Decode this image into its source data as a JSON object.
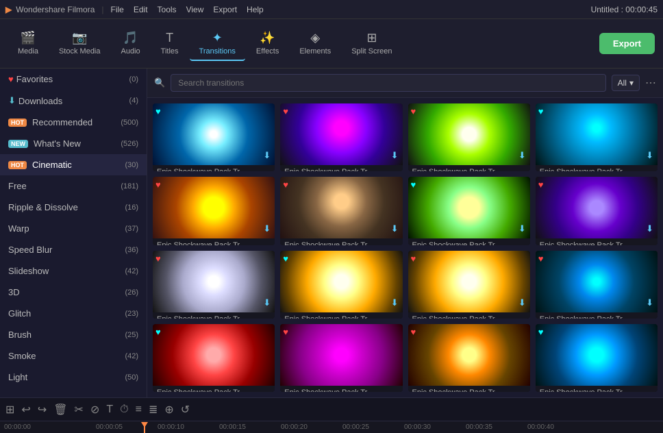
{
  "topbar": {
    "logo": "Wondershare Filmora",
    "menus": [
      "File",
      "Edit",
      "Tools",
      "View",
      "Export",
      "Help"
    ],
    "title": "Untitled : 00:00:45"
  },
  "toolbar": {
    "items": [
      {
        "id": "media",
        "label": "Media",
        "icon": "🎬"
      },
      {
        "id": "stock",
        "label": "Stock Media",
        "icon": "📷"
      },
      {
        "id": "audio",
        "label": "Audio",
        "icon": "🎵"
      },
      {
        "id": "titles",
        "label": "Titles",
        "icon": "T"
      },
      {
        "id": "transitions",
        "label": "Transitions",
        "icon": "✦",
        "active": true
      },
      {
        "id": "effects",
        "label": "Effects",
        "icon": "✨"
      },
      {
        "id": "elements",
        "label": "Elements",
        "icon": "◈"
      },
      {
        "id": "split",
        "label": "Split Screen",
        "icon": "⊞"
      }
    ],
    "export_label": "Export"
  },
  "sidebar": {
    "items": [
      {
        "id": "favorites",
        "label": "Favorites",
        "count": "(0)",
        "icon": "♥",
        "badge": ""
      },
      {
        "id": "downloads",
        "label": "Downloads",
        "count": "(4)",
        "icon": "⬇",
        "badge": ""
      },
      {
        "id": "recommended",
        "label": "Recommended",
        "count": "(500)",
        "icon": "",
        "badge": "HOT"
      },
      {
        "id": "whats-new",
        "label": "What's New",
        "count": "(526)",
        "icon": "",
        "badge": "NEW"
      },
      {
        "id": "cinematic",
        "label": "Cinematic",
        "count": "(30)",
        "icon": "",
        "badge": "HOT",
        "active": true
      },
      {
        "id": "free",
        "label": "Free",
        "count": "(181)",
        "icon": ""
      },
      {
        "id": "ripple",
        "label": "Ripple & Dissolve",
        "count": "(16)",
        "icon": ""
      },
      {
        "id": "warp",
        "label": "Warp",
        "count": "(37)",
        "icon": ""
      },
      {
        "id": "speed-blur",
        "label": "Speed Blur",
        "count": "(36)",
        "icon": ""
      },
      {
        "id": "slideshow",
        "label": "Slideshow",
        "count": "(42)",
        "icon": ""
      },
      {
        "id": "3d",
        "label": "3D",
        "count": "(26)",
        "icon": ""
      },
      {
        "id": "glitch",
        "label": "Glitch",
        "count": "(23)",
        "icon": ""
      },
      {
        "id": "brush",
        "label": "Brush",
        "count": "(25)",
        "icon": ""
      },
      {
        "id": "smoke",
        "label": "Smoke",
        "count": "(42)",
        "icon": ""
      },
      {
        "id": "light",
        "label": "Light",
        "count": "(50)",
        "icon": ""
      }
    ]
  },
  "search": {
    "placeholder": "Search transitions",
    "filter": "All"
  },
  "grid": {
    "items": [
      {
        "label": "Epic Shockwave Pack Tr...",
        "thumb": "thumb-1",
        "heart": true,
        "download": true
      },
      {
        "label": "Epic Shockwave Pack Tr...",
        "thumb": "thumb-2",
        "heart": true,
        "download": true
      },
      {
        "label": "Epic Shockwave Pack Tr...",
        "thumb": "thumb-3",
        "heart": true,
        "download": true
      },
      {
        "label": "Epic Shockwave Pack Tr...",
        "thumb": "thumb-4",
        "heart": true,
        "download": true
      },
      {
        "label": "Epic Shockwave Pack Tr...",
        "thumb": "thumb-5",
        "heart": true,
        "download": true
      },
      {
        "label": "Epic Shockwave Pack Tr...",
        "thumb": "thumb-6",
        "heart": true,
        "download": true
      },
      {
        "label": "Epic Shockwave Pack Tr...",
        "thumb": "thumb-7",
        "heart": true,
        "download": true
      },
      {
        "label": "Epic Shockwave Pack Tr...",
        "thumb": "thumb-8",
        "heart": true,
        "download": true
      },
      {
        "label": "Epic Shockwave Pack Tr...",
        "thumb": "thumb-9",
        "heart": true,
        "download": true
      },
      {
        "label": "Epic Shockwave Pack Tr...",
        "thumb": "thumb-10",
        "heart": true,
        "download": true
      },
      {
        "label": "Epic Shockwave Pack Tr...",
        "thumb": "thumb-11",
        "heart": true,
        "download": true
      },
      {
        "label": "Epic Shockwave Pack Tr...",
        "thumb": "thumb-12",
        "heart": true,
        "download": true
      },
      {
        "label": "Epic Shockwave Pack Tr...",
        "thumb": "thumb-13",
        "heart": true,
        "download": false
      },
      {
        "label": "Epic Shockwave Pack Tr...",
        "thumb": "thumb-14",
        "heart": true,
        "download": false
      },
      {
        "label": "Epic Shockwave Pack Tr...",
        "thumb": "thumb-15",
        "heart": true,
        "download": false
      },
      {
        "label": "Epic Shockwave Pack Tr...",
        "thumb": "thumb-16",
        "heart": true,
        "download": false
      }
    ]
  },
  "timeline": {
    "tools": [
      "⊞",
      "↩",
      "↪",
      "🗑",
      "✂",
      "⊘",
      "T",
      "⏱",
      "≡",
      "≣",
      "⊕",
      "↺"
    ],
    "marks": [
      "00:00:00",
      "00:00:05",
      "00:00:10",
      "00:00:15",
      "00:00:20",
      "00:00:25",
      "00:00:30",
      "00:00:35",
      "00:00:40"
    ]
  }
}
